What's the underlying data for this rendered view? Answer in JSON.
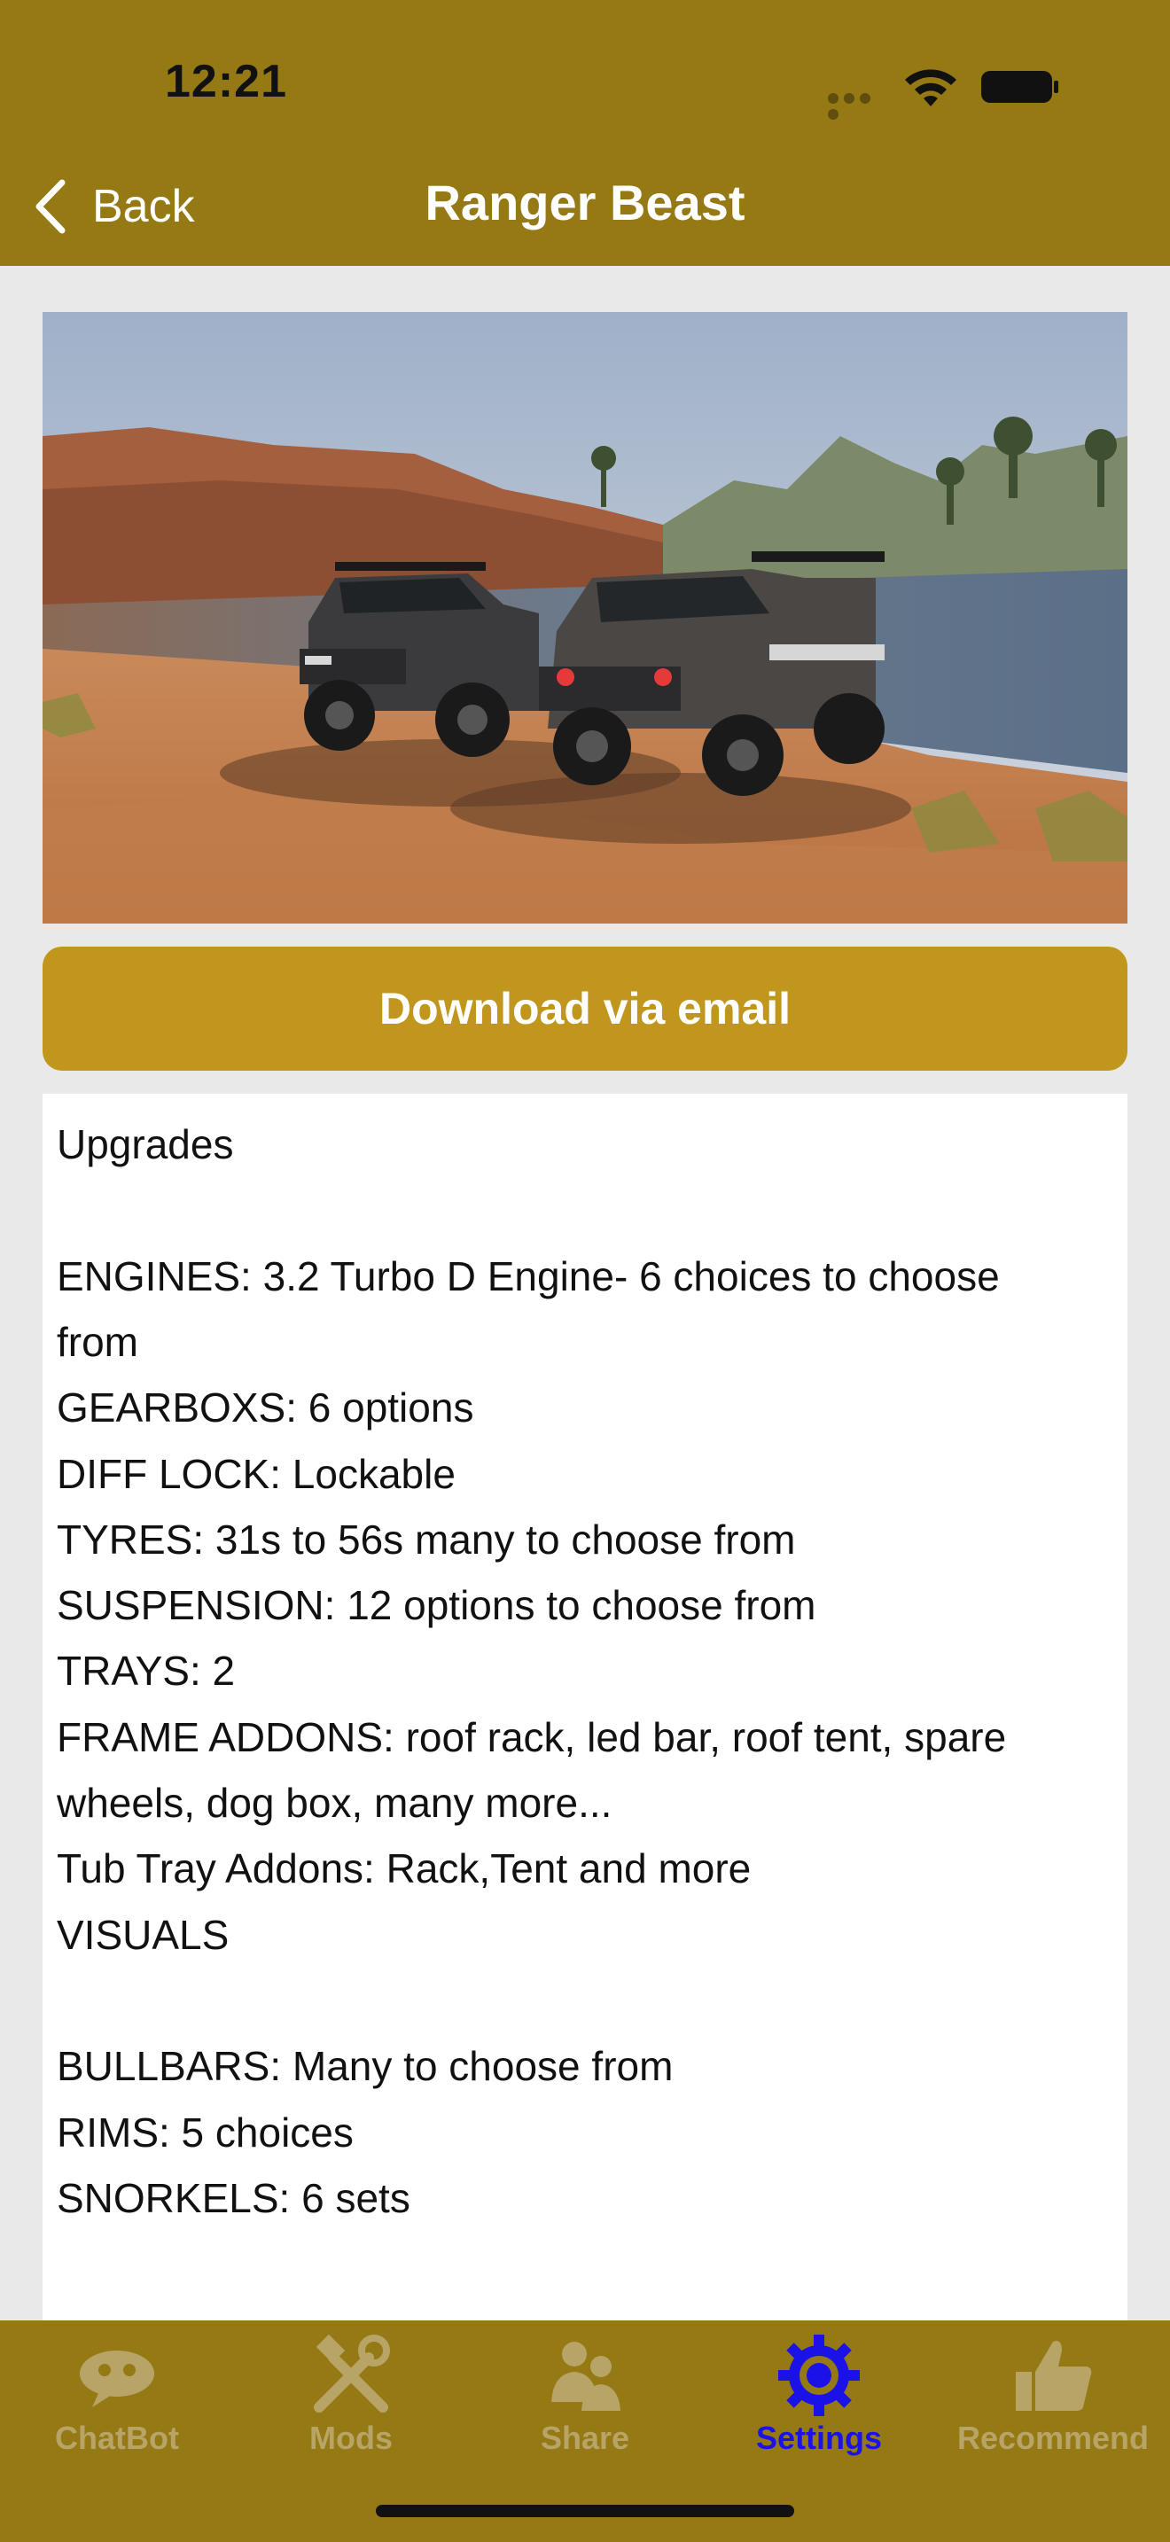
{
  "status": {
    "time": "12:21"
  },
  "nav": {
    "back_label": "Back",
    "title": "Ranger Beast"
  },
  "hero": {
    "alt": "Two off-road Ford Ranger trucks on red desert rock beside a lake"
  },
  "download_label": "Download via email",
  "description": {
    "lines": [
      "Upgrades",
      "",
      "ENGINES: 3.2 Turbo D Engine- 6 choices to choose",
      "from",
      "GEARBOXS: 6 options",
      "DIFF LOCK: Lockable",
      "TYRES: 31s to 56s many to choose from",
      "SUSPENSION: 12 options to choose from",
      "TRAYS: 2",
      "FRAME ADDONS: roof rack, led bar, roof tent, spare",
      "wheels, dog box, many more...",
      "Tub Tray Addons: Rack,Tent and more",
      "VISUALS",
      "",
      "BULLBARS: Many to choose from",
      "RIMS: 5 choices",
      "SNORKELS: 6 sets"
    ]
  },
  "tabs": [
    {
      "label": "ChatBot",
      "icon": "chatbot-icon",
      "active": false
    },
    {
      "label": "Mods",
      "icon": "tools-icon",
      "active": false
    },
    {
      "label": "Share",
      "icon": "share-people-icon",
      "active": false
    },
    {
      "label": "Settings",
      "icon": "gear-icon",
      "active": true
    },
    {
      "label": "Recommend",
      "icon": "thumbs-up-icon",
      "active": false
    }
  ],
  "colors": {
    "header": "#947914",
    "button": "#c0971c",
    "tab_active": "#1a12e6",
    "tab_inactive": "#b8a466"
  }
}
